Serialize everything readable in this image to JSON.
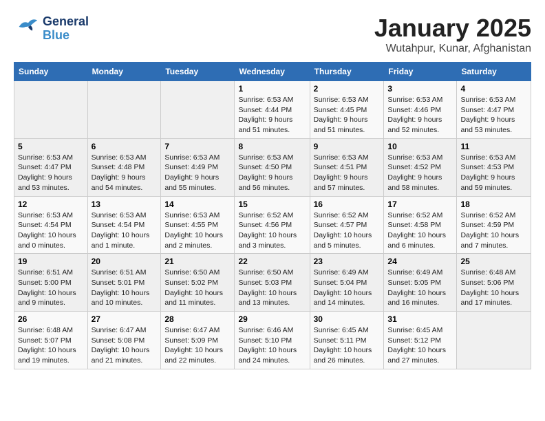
{
  "header": {
    "logo_line1": "General",
    "logo_line2": "Blue",
    "title": "January 2025",
    "subtitle": "Wutahpur, Kunar, Afghanistan"
  },
  "days_of_week": [
    "Sunday",
    "Monday",
    "Tuesday",
    "Wednesday",
    "Thursday",
    "Friday",
    "Saturday"
  ],
  "weeks": [
    [
      {
        "day": "",
        "detail": ""
      },
      {
        "day": "",
        "detail": ""
      },
      {
        "day": "",
        "detail": ""
      },
      {
        "day": "1",
        "detail": "Sunrise: 6:53 AM\nSunset: 4:44 PM\nDaylight: 9 hours and 51 minutes."
      },
      {
        "day": "2",
        "detail": "Sunrise: 6:53 AM\nSunset: 4:45 PM\nDaylight: 9 hours and 51 minutes."
      },
      {
        "day": "3",
        "detail": "Sunrise: 6:53 AM\nSunset: 4:46 PM\nDaylight: 9 hours and 52 minutes."
      },
      {
        "day": "4",
        "detail": "Sunrise: 6:53 AM\nSunset: 4:47 PM\nDaylight: 9 hours and 53 minutes."
      }
    ],
    [
      {
        "day": "5",
        "detail": "Sunrise: 6:53 AM\nSunset: 4:47 PM\nDaylight: 9 hours and 53 minutes."
      },
      {
        "day": "6",
        "detail": "Sunrise: 6:53 AM\nSunset: 4:48 PM\nDaylight: 9 hours and 54 minutes."
      },
      {
        "day": "7",
        "detail": "Sunrise: 6:53 AM\nSunset: 4:49 PM\nDaylight: 9 hours and 55 minutes."
      },
      {
        "day": "8",
        "detail": "Sunrise: 6:53 AM\nSunset: 4:50 PM\nDaylight: 9 hours and 56 minutes."
      },
      {
        "day": "9",
        "detail": "Sunrise: 6:53 AM\nSunset: 4:51 PM\nDaylight: 9 hours and 57 minutes."
      },
      {
        "day": "10",
        "detail": "Sunrise: 6:53 AM\nSunset: 4:52 PM\nDaylight: 9 hours and 58 minutes."
      },
      {
        "day": "11",
        "detail": "Sunrise: 6:53 AM\nSunset: 4:53 PM\nDaylight: 9 hours and 59 minutes."
      }
    ],
    [
      {
        "day": "12",
        "detail": "Sunrise: 6:53 AM\nSunset: 4:54 PM\nDaylight: 10 hours and 0 minutes."
      },
      {
        "day": "13",
        "detail": "Sunrise: 6:53 AM\nSunset: 4:54 PM\nDaylight: 10 hours and 1 minute."
      },
      {
        "day": "14",
        "detail": "Sunrise: 6:53 AM\nSunset: 4:55 PM\nDaylight: 10 hours and 2 minutes."
      },
      {
        "day": "15",
        "detail": "Sunrise: 6:52 AM\nSunset: 4:56 PM\nDaylight: 10 hours and 3 minutes."
      },
      {
        "day": "16",
        "detail": "Sunrise: 6:52 AM\nSunset: 4:57 PM\nDaylight: 10 hours and 5 minutes."
      },
      {
        "day": "17",
        "detail": "Sunrise: 6:52 AM\nSunset: 4:58 PM\nDaylight: 10 hours and 6 minutes."
      },
      {
        "day": "18",
        "detail": "Sunrise: 6:52 AM\nSunset: 4:59 PM\nDaylight: 10 hours and 7 minutes."
      }
    ],
    [
      {
        "day": "19",
        "detail": "Sunrise: 6:51 AM\nSunset: 5:00 PM\nDaylight: 10 hours and 9 minutes."
      },
      {
        "day": "20",
        "detail": "Sunrise: 6:51 AM\nSunset: 5:01 PM\nDaylight: 10 hours and 10 minutes."
      },
      {
        "day": "21",
        "detail": "Sunrise: 6:50 AM\nSunset: 5:02 PM\nDaylight: 10 hours and 11 minutes."
      },
      {
        "day": "22",
        "detail": "Sunrise: 6:50 AM\nSunset: 5:03 PM\nDaylight: 10 hours and 13 minutes."
      },
      {
        "day": "23",
        "detail": "Sunrise: 6:49 AM\nSunset: 5:04 PM\nDaylight: 10 hours and 14 minutes."
      },
      {
        "day": "24",
        "detail": "Sunrise: 6:49 AM\nSunset: 5:05 PM\nDaylight: 10 hours and 16 minutes."
      },
      {
        "day": "25",
        "detail": "Sunrise: 6:48 AM\nSunset: 5:06 PM\nDaylight: 10 hours and 17 minutes."
      }
    ],
    [
      {
        "day": "26",
        "detail": "Sunrise: 6:48 AM\nSunset: 5:07 PM\nDaylight: 10 hours and 19 minutes."
      },
      {
        "day": "27",
        "detail": "Sunrise: 6:47 AM\nSunset: 5:08 PM\nDaylight: 10 hours and 21 minutes."
      },
      {
        "day": "28",
        "detail": "Sunrise: 6:47 AM\nSunset: 5:09 PM\nDaylight: 10 hours and 22 minutes."
      },
      {
        "day": "29",
        "detail": "Sunrise: 6:46 AM\nSunset: 5:10 PM\nDaylight: 10 hours and 24 minutes."
      },
      {
        "day": "30",
        "detail": "Sunrise: 6:45 AM\nSunset: 5:11 PM\nDaylight: 10 hours and 26 minutes."
      },
      {
        "day": "31",
        "detail": "Sunrise: 6:45 AM\nSunset: 5:12 PM\nDaylight: 10 hours and 27 minutes."
      },
      {
        "day": "",
        "detail": ""
      }
    ]
  ]
}
